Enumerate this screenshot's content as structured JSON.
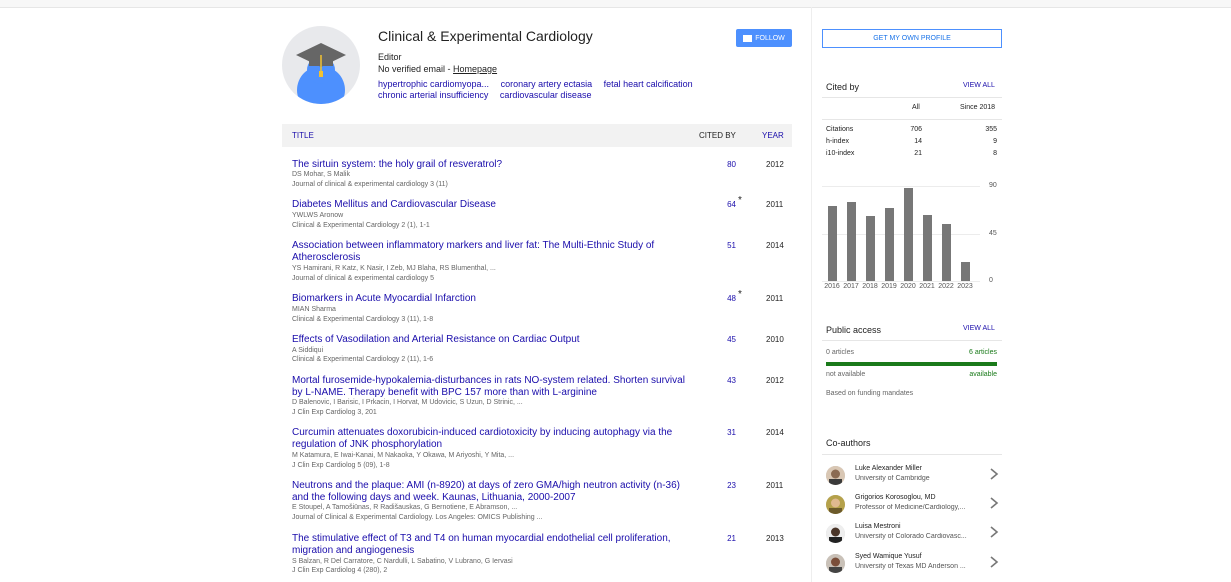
{
  "profile": {
    "name": "Clinical & Experimental Cardiology",
    "role": "Editor",
    "email_text": "No verified email - ",
    "homepage_label": "Homepage",
    "interests": [
      "hypertrophic cardiomyopa...",
      "coronary artery ectasia",
      "fetal heart calcification",
      "chronic arterial insufficiency",
      "cardiovascular disease"
    ],
    "follow_label": "FOLLOW"
  },
  "table": {
    "header": {
      "title": "TITLE",
      "cited_by": "CITED BY",
      "year": "YEAR"
    },
    "rows": [
      {
        "title": "The sirtuin system: the holy grail of resveratrol?",
        "authors": "DS Mohar, S Malik",
        "venue": "Journal of clinical & experimental cardiology 3 (11)",
        "cited": "80",
        "star": "",
        "year": "2012"
      },
      {
        "title": "Diabetes Mellitus and Cardiovascular Disease",
        "authors": "YWLWS Aronow",
        "venue": "Clinical & Experimental Cardiology 2 (1), 1-1",
        "cited": "64",
        "star": "*",
        "year": "2011"
      },
      {
        "title": "Association between inflammatory markers and liver fat: The Multi-Ethnic Study of Atherosclerosis",
        "authors": "YS Hamirani, R Katz, K Nasir, I Zeb, MJ Blaha, RS Blumenthal, ...",
        "venue": "Journal of clinical & experimental cardiology 5",
        "cited": "51",
        "star": "",
        "year": "2014"
      },
      {
        "title": "Biomarkers in Acute Myocardial Infarction",
        "authors": "MIAN Sharma",
        "venue": "Clinical & Experimental Cardiology 3 (11), 1-8",
        "cited": "48",
        "star": "*",
        "year": "2011"
      },
      {
        "title": "Effects of Vasodilation and Arterial Resistance on Cardiac Output",
        "authors": "A Siddiqui",
        "venue": "Clinical & Experimental Cardiology 2 (11), 1-6",
        "cited": "45",
        "star": "",
        "year": "2010"
      },
      {
        "title": "Mortal furosemide-hypokalemia-disturbances in rats NO-system related. Shorten survival by L-NAME. Therapy benefit with BPC 157 more than with L-arginine",
        "authors": "D Balenovic, I Barisic, I Prkacin, I Horvat, M Udovicic, S Uzun, D Strinic, ...",
        "venue": "J Clin Exp Cardiolog 3, 201",
        "cited": "43",
        "star": "",
        "year": "2012"
      },
      {
        "title": "Curcumin attenuates doxorubicin-induced cardiotoxicity by inducing autophagy via the regulation of JNK phosphorylation",
        "authors": "M Katamura, E Iwai-Kanai, M Nakaoka, Y Okawa, M Ariyoshi, Y Mita, ...",
        "venue": "J Clin Exp Cardiolog 5 (09), 1-8",
        "cited": "31",
        "star": "",
        "year": "2014"
      },
      {
        "title": "Neutrons and the plaque: AMI (n-8920) at days of zero GMA/high neutron activity (n-36) and the following days and week. Kaunas, Lithuania, 2000-2007",
        "authors": "E Stoupel, A Tamošiūnas, R Radišauskas, G Bernotiene, E Abramson, ...",
        "venue": "Journal of Clinical & Experimental Cardiology. Los Angeles: OMICS Publishing ...",
        "cited": "23",
        "star": "",
        "year": "2011"
      },
      {
        "title": "The stimulative effect of T3 and T4 on human myocardial endothelial cell proliferation, migration and angiogenesis",
        "authors": "S Balzan, R Del Carratore, C Nardulli, L Sabatino, V Lubrano, G Iervasi",
        "venue": "J Clin Exp Cardiolog 4 (280), 2",
        "cited": "21",
        "star": "",
        "year": "2013"
      }
    ]
  },
  "sidebar": {
    "own_profile_label": "GET MY OWN PROFILE",
    "cited_by": {
      "title": "Cited by",
      "view_all": "VIEW ALL",
      "col_all": "All",
      "col_since": "Since 2018",
      "rows": [
        {
          "label": "Citations",
          "all": "706",
          "since": "355"
        },
        {
          "label": "h-index",
          "all": "14",
          "since": "9"
        },
        {
          "label": "i10-index",
          "all": "21",
          "since": "8"
        }
      ]
    },
    "public_access": {
      "title": "Public access",
      "view_all": "VIEW ALL",
      "left_count": "0 articles",
      "right_count": "6 articles",
      "left_status": "not available",
      "right_status": "available",
      "available_fraction": 1.0,
      "note": "Based on funding mandates"
    },
    "coauthors": {
      "title": "Co-authors",
      "items": [
        {
          "name": "Luke Alexander Miller",
          "affiliation": "University of Cambridge"
        },
        {
          "name": "Grigorios Korosoglou, MD",
          "affiliation": "Professor of Medicine/Cardiology,..."
        },
        {
          "name": "Luisa Mestroni",
          "affiliation": "University of Colorado Cardiovasc..."
        },
        {
          "name": "Syed Wamique Yusuf",
          "affiliation": "University of Texas MD Anderson ..."
        }
      ]
    }
  },
  "chart_data": {
    "type": "bar",
    "categories": [
      "2016",
      "2017",
      "2018",
      "2019",
      "2020",
      "2021",
      "2022",
      "2023"
    ],
    "values": [
      71,
      75,
      62,
      69,
      88,
      63,
      54,
      18
    ],
    "yticks": [
      "90",
      "45",
      "0"
    ],
    "ylim": [
      0,
      90
    ],
    "grid": true,
    "bar_color": "#777777"
  }
}
